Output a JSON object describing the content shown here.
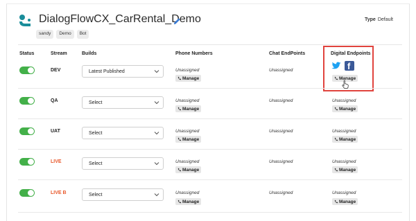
{
  "header": {
    "title": "DialogFlowCX_CarRental_Demo",
    "tags": [
      "sandy",
      "Demo",
      "Bot"
    ],
    "type_label": "Type",
    "type_value": "Default"
  },
  "columns": {
    "status": "Status",
    "stream": "Stream",
    "builds": "Builds",
    "phone": "Phone Numbers",
    "chat": "Chat EndPoints",
    "digital": "Digital Endpoints"
  },
  "rows": [
    {
      "stream": "DEV",
      "build": "Latest Published",
      "phone": "Unassigned",
      "phone_manage": "Manage",
      "chat": "Unassigned",
      "digital_manage": "Manage",
      "status_on": true
    },
    {
      "stream": "QA",
      "build": "Select",
      "phone": "Unassigned",
      "phone_manage": "Manage",
      "chat": "Unassigned",
      "digital": "Unassigned",
      "digital_manage": "Manage",
      "status_on": true
    },
    {
      "stream": "UAT",
      "build": "Select",
      "phone": "Unassigned",
      "phone_manage": "Manage",
      "chat": "Unassigned",
      "digital": "Unassigned",
      "digital_manage": "Manage",
      "status_on": true
    },
    {
      "stream": "LIVE",
      "build": "Select",
      "phone": "Unassigned",
      "phone_manage": "Manage",
      "chat": "Unassigned",
      "digital": "Unassigned",
      "digital_manage": "Manage",
      "status_on": true
    },
    {
      "stream": "LIVE B",
      "build": "Select",
      "phone": "Unassigned",
      "phone_manage": "Manage",
      "chat": "Unassigned",
      "digital": "Unassigned",
      "digital_manage": "Manage",
      "status_on": true
    }
  ],
  "colors": {
    "toggle_on": "#43b049",
    "live_stream": "#e8572a",
    "highlight": "#e0433d",
    "twitter": "#1da1f2",
    "facebook": "#3b5998",
    "logo": "#1a8d9a"
  },
  "icons": {
    "logo": "dialogflow-logo-icon",
    "edit": "pencil-icon",
    "phone": "phone-icon",
    "caret": "chevron-down-icon",
    "twitter": "twitter-icon",
    "facebook": "facebook-icon",
    "cursor": "hand-pointer-icon"
  },
  "facebook_glyph": "f"
}
